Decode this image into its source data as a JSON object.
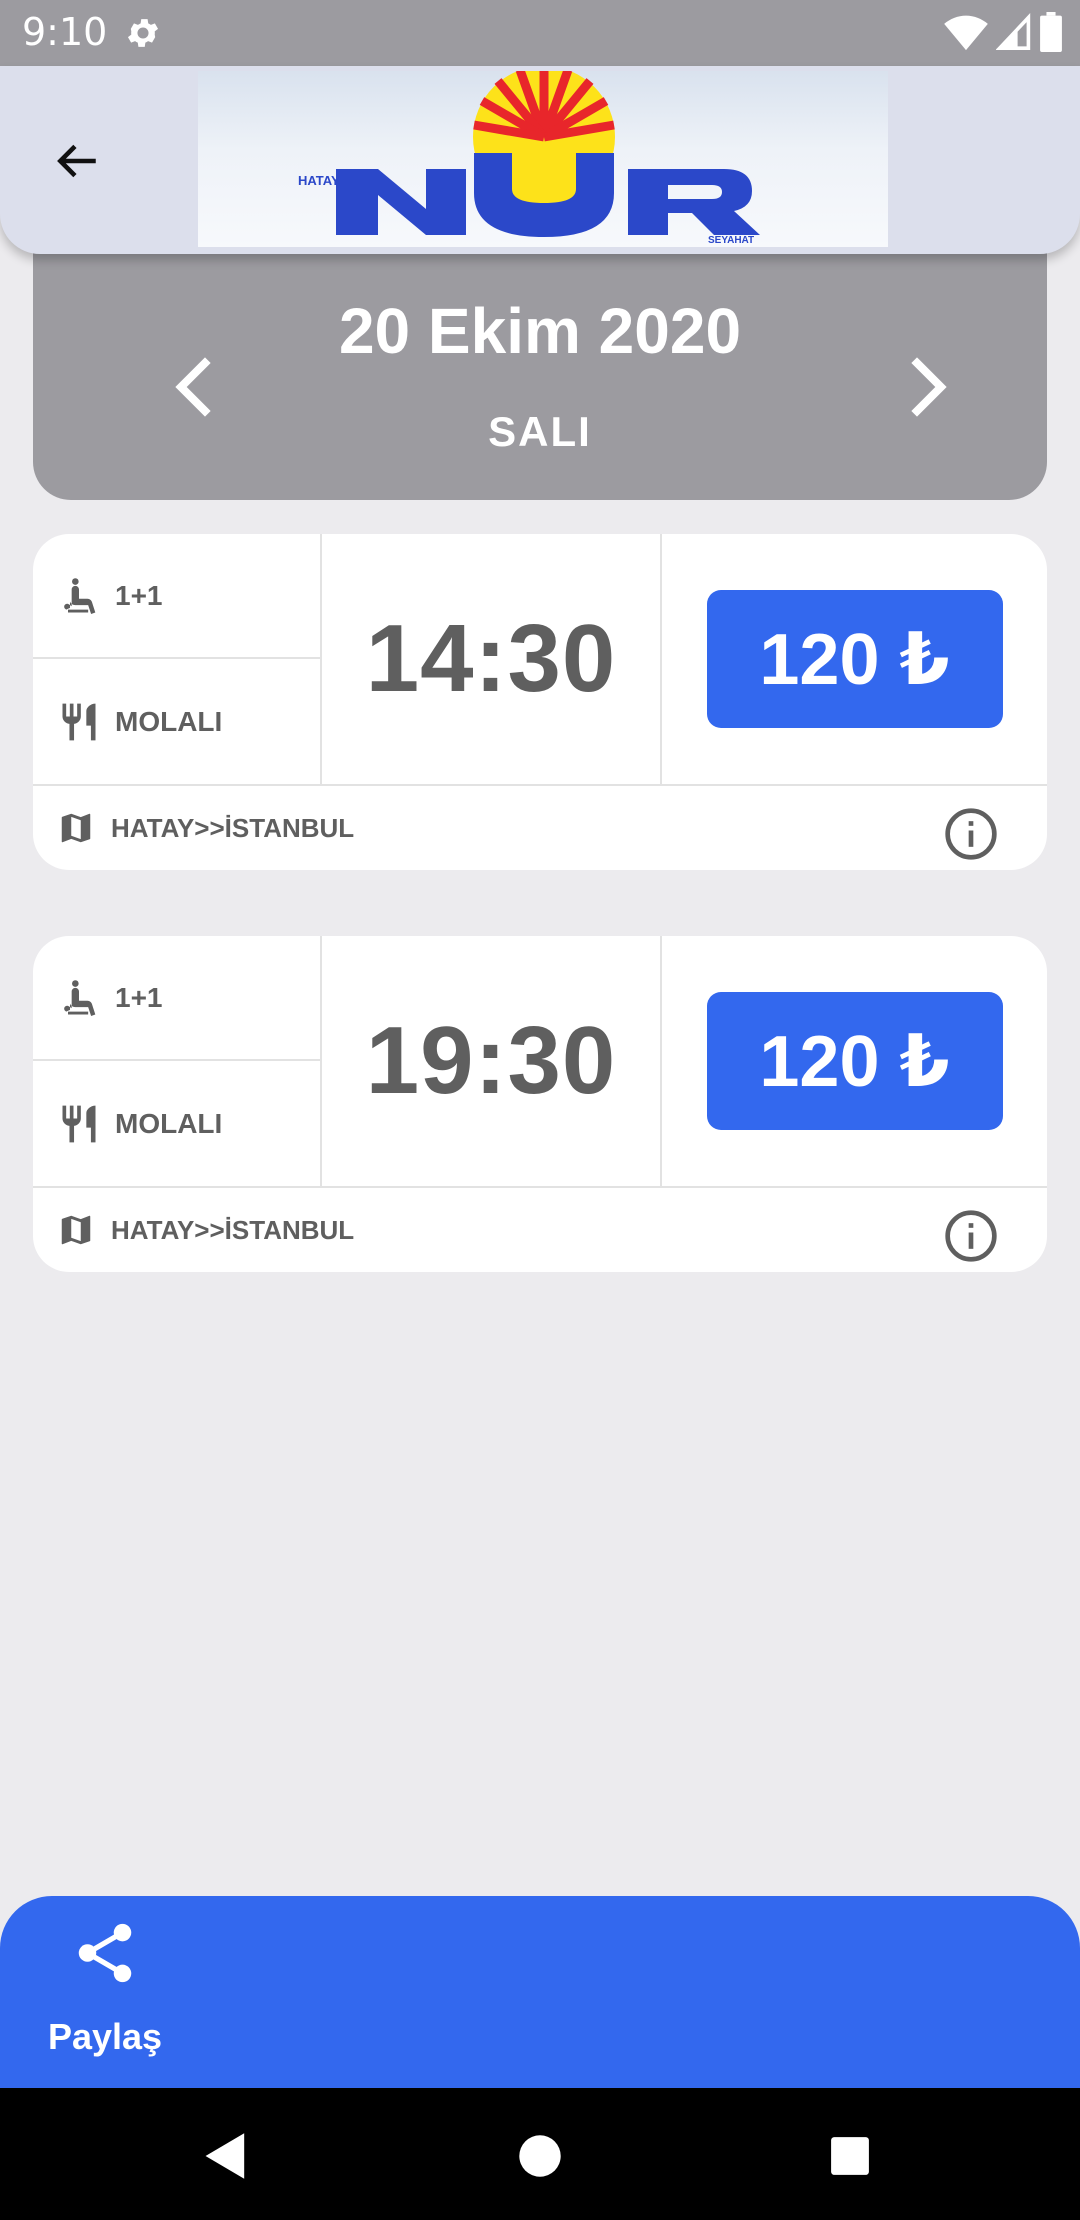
{
  "status_bar": {
    "time": "9:10"
  },
  "header": {
    "logo": {
      "top_text": "HATAY",
      "main_text": "NUR",
      "bottom_text": "SEYAHAT"
    }
  },
  "date_card": {
    "date": "20 Ekim 2020",
    "day": "SALI"
  },
  "trips": [
    {
      "seat_layout": "1+1",
      "break_label": "MOLALI",
      "time": "14:30",
      "price": "120 ₺",
      "route": "HATAY>>İSTANBUL"
    },
    {
      "seat_layout": "1+1",
      "break_label": "MOLALI",
      "time": "19:30",
      "price": "120 ₺",
      "route": "HATAY>>İSTANBUL"
    }
  ],
  "bottom_bar": {
    "share_label": "Paylaş"
  },
  "colors": {
    "accent": "#3368ee",
    "header_gray": "#9c9ba0",
    "background": "#ecebee",
    "logo_red": "#e8262b",
    "logo_yellow": "#fde21a"
  },
  "icons": [
    "settings-icon",
    "wifi-icon",
    "signal-icon",
    "battery-icon",
    "back-arrow-icon",
    "chevron-left-icon",
    "chevron-right-icon",
    "seat-icon",
    "restaurant-icon",
    "map-icon",
    "info-icon",
    "share-icon"
  ]
}
